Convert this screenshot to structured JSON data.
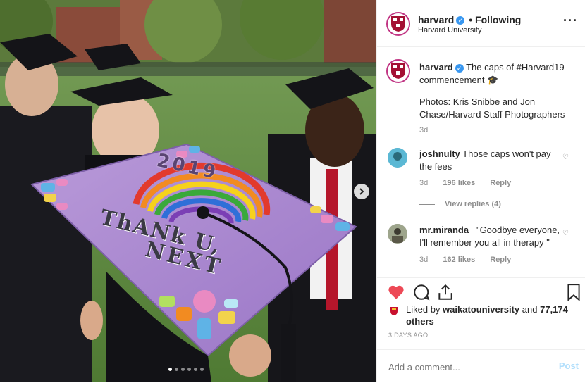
{
  "header": {
    "username": "harvard",
    "follow_status": "• Following",
    "subtitle": "Harvard University",
    "more_icon": "ellipsis-icon"
  },
  "caption": {
    "username": "harvard",
    "text": "The caps of #Harvard19 commencement 🎓",
    "credit": "Photos: Kris Snibbe and Jon Chase/Harvard Staff Photographers",
    "time": "3d"
  },
  "comments": [
    {
      "username": "joshnulty",
      "text": "Those caps won't pay the fees",
      "time": "3d",
      "likes": "196 likes",
      "reply": "Reply"
    },
    {
      "username": "mr.miranda_",
      "text": "\"Goodbye everyone, I'll remember you all in therapy \"",
      "time": "3d",
      "likes": "162 likes",
      "reply": "Reply"
    }
  ],
  "view_replies": "View replies (4)",
  "likes": {
    "prefix": "Liked by",
    "user": "waikatouniversity",
    "and": "and",
    "others": "77,174 others",
    "date": "3 DAYS AGO"
  },
  "add_comment": {
    "placeholder": "Add a comment...",
    "post_label": "Post"
  },
  "photo": {
    "cap_year": "2019",
    "cap_line1": "ThANk U,",
    "cap_line2": "NEXT",
    "carousel_count": 6,
    "carousel_active": 1
  },
  "colors": {
    "accent_blue": "#3897f0",
    "like_red": "#ed4956",
    "post_blue": "#b2dffc"
  }
}
